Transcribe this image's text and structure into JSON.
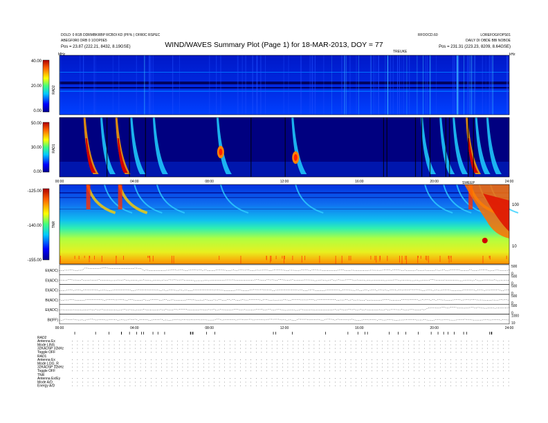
{
  "header": {
    "title": "WIND/WAVES Summary Plot (Page 1) for 18-MAR-2013, DOY = 77",
    "top_left_line1": "DOLD: 0 R1B DDRMBKRBP RCBOI KD (PF% ) OFR0C RSPEC",
    "top_left_line2": "ABEGF0R0 ORB 0 1OOP0E5",
    "top_left_line3": "Pos = 23.87 (222.21, 8432, 8.19GSE)",
    "top_right_line1": "LOREFOGFOPS01",
    "top_right_line2": "DAILY DI OBDE BBI NOBOE",
    "top_right_line3": "Pos = 231.31 (223.23, 8209, 8.64GSE)",
    "top_mid_right": "RFOOCD.60",
    "tnr_label_top": "TREUKE",
    "corner_left": "MHz",
    "corner_right": "kHz",
    "sweep_label": "SWEEP"
  },
  "panels": {
    "rad2": {
      "name": "RAD2",
      "ticks": [
        "40.00",
        "20.00",
        "0.00"
      ]
    },
    "rad1": {
      "name": "RAD1",
      "ticks": [
        "50.00",
        "30.00",
        "0.00"
      ]
    },
    "tnr": {
      "name": "TNR",
      "ticks": [
        "-125.00",
        "-140.00",
        "-155.00"
      ],
      "right_ticks": [
        "100",
        "10"
      ]
    },
    "lines": [
      {
        "label": "EI(ADC)",
        "right": [
          "500",
          "0"
        ]
      },
      {
        "label": "EI(ADC)",
        "right": [
          "500",
          "0"
        ]
      },
      {
        "label": "EI(ADC)",
        "right": [
          "500",
          "0"
        ]
      },
      {
        "label": "BI(ADC)",
        "right": [
          "500",
          "0"
        ]
      },
      {
        "label": "EI(ADC)",
        "right": [
          "500",
          "0"
        ]
      },
      {
        "label": "BI(IFF)",
        "right": [
          "1000",
          "10"
        ]
      }
    ]
  },
  "chart_data": {
    "type": "heatmap",
    "title": "WIND/WAVES Summary Plot (Page 1) for 18-MAR-2013, DOY = 77",
    "x_tick_labels": [
      "00:00",
      "04:00",
      "08:00",
      "12:00",
      "16:00",
      "20:00",
      "24:00"
    ],
    "x_range_hours": [
      0,
      24
    ],
    "rad2_y_range": [
      0,
      40
    ],
    "rad1_y_range": [
      0,
      50
    ],
    "tnr_y_range": [
      -155,
      -125
    ],
    "type3_burst_hours": [
      1.5,
      2.4,
      3.2,
      4.0,
      5.2,
      8.6,
      12.6,
      19.5,
      20.5,
      21.2,
      21.9,
      22.4,
      23.0
    ],
    "intense_burst_hours": [
      1.5,
      3.3,
      22.0
    ]
  },
  "footer": {
    "rad2_head": "RAD2",
    "rad2_rows": [
      "Antenna  Ex",
      "Mode  LINS",
      "32KADSP  32kHz",
      "Toggle  OFF"
    ],
    "rad1_head": "RAD1",
    "rad1_rows": [
      "Antenna  Ex",
      "Mode  LOG_R",
      "32KADSP  32kHz",
      "Toggle  OFF"
    ],
    "tnr_head": "TNR",
    "tnr_rows": [
      "Antenna  Ex/Ey",
      "Mode  A/D",
      "Energy  A/D"
    ]
  }
}
